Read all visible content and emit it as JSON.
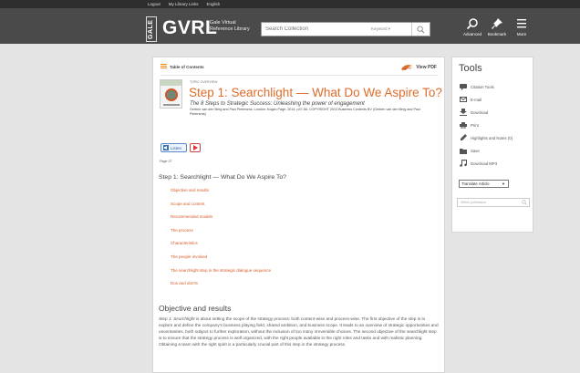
{
  "topbar": {
    "links": [
      "Logout",
      "My Library Links",
      "English"
    ]
  },
  "header": {
    "brand_badge": "GALE",
    "brand_name": "GVRL",
    "brand_sub": "Gale Virtual Reference Library",
    "search": {
      "placeholder": "Search Collection",
      "scope": "Keyword"
    },
    "buttons": {
      "advanced": "Advanced",
      "bookmark": "Bookmark",
      "more": "More"
    }
  },
  "article": {
    "toc_link": "Table of Contents",
    "pdf_link": "View PDF",
    "type_label": "TOPIC OVERVIEW",
    "title": "Step 1: Searchlight — What Do We Aspire To?",
    "subtitle": "The 8 Steps to Strategic Success: Unleashing the power of engagement",
    "source": "Gerben van den Berg and Paul Pietersma. London: Kogan Page, 2014. p37-56. COPYRIGHT 2014 Business Contents BV (Gerben van den Berg and Paul Pietersma)",
    "listen_label": "Listen",
    "page_label": "Page 37",
    "section_heading": "Step 1: Searchlight — What Do We Aspire To?",
    "toc_items": [
      "Objective and results",
      "Scope and content",
      "Recommended models",
      "The process",
      "Characteristics",
      "The people involved",
      "The searchlight step in the strategic dialogue sequence",
      "Dos and don'ts"
    ],
    "obj_heading": "Objective and results",
    "obj_body_lead": "Step 1: Searchlight",
    "obj_body": " is about setting the scope of the strategy process: both content-wise and process-wise. The first objective of the step is to explore and define the company's business playing field, shared ambition, and business scope. It leads to an overview of strategic opportunities and uncertainties, both subject to further exploration, without the inclusion of too many irreversible choices. The second objective of the searchlight step is to ensure that the strategy process is well organized, with the right people available in the right roles and tasks and with realistic planning. Obtaining a team with the right spirit is a particularly crucial part of this step in the strategy process."
  },
  "tools": {
    "title": "Tools",
    "items": [
      {
        "label": "Citation Tools",
        "icon": "citation-icon"
      },
      {
        "label": "E-mail",
        "icon": "email-icon"
      },
      {
        "label": "Download",
        "icon": "download-icon"
      },
      {
        "label": "Print",
        "icon": "print-icon"
      },
      {
        "label": "Highlights and Notes (0)",
        "icon": "highlight-icon"
      },
      {
        "label": "Save",
        "icon": "folder-icon"
      },
      {
        "label": "Download MP3",
        "icon": "music-note-icon"
      }
    ],
    "translate_label": "Translate Article",
    "within_pub_placeholder": "Within publication"
  },
  "colors": {
    "accent_orange": "#e06b2a",
    "header_bg": "#4a4a4a",
    "topbar_bg": "#2e2e2e",
    "link_orange": "#d65b25"
  }
}
